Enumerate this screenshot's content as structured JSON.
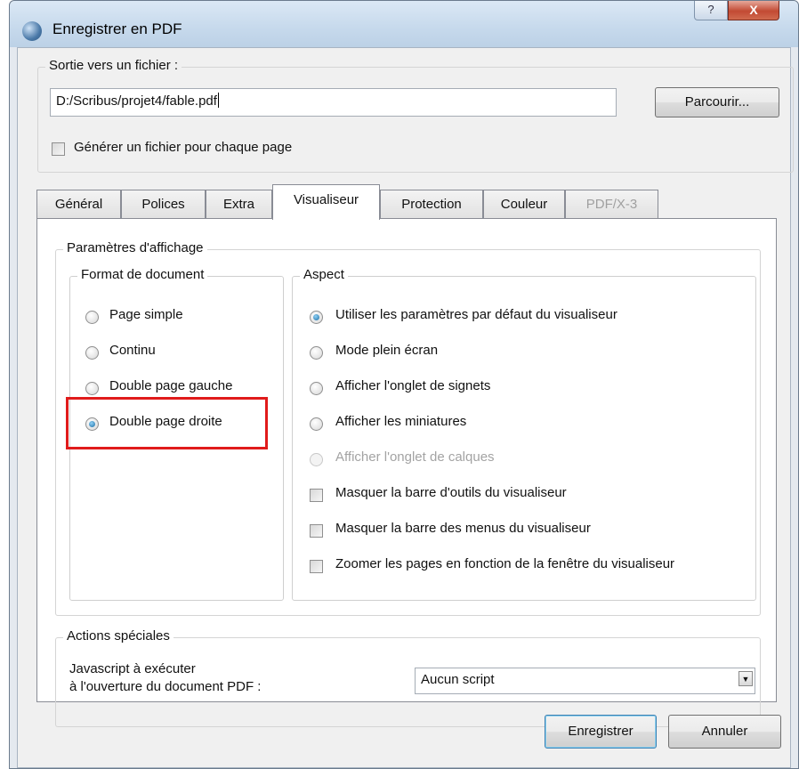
{
  "window": {
    "title": "Enregistrer en PDF",
    "help_glyph": "?",
    "close_glyph": "X"
  },
  "output": {
    "group_label": "Sortie vers un fichier :",
    "path_value": "D:/Scribus/projet4/fable.pdf",
    "browse_label": "Parcourir...",
    "per_page_label": "Générer un fichier pour chaque page",
    "per_page_checked": false
  },
  "tabs": [
    {
      "label": "Général",
      "active": false,
      "disabled": false
    },
    {
      "label": "Polices",
      "active": false,
      "disabled": false
    },
    {
      "label": "Extra",
      "active": false,
      "disabled": false
    },
    {
      "label": "Visualiseur",
      "active": true,
      "disabled": false
    },
    {
      "label": "Protection",
      "active": false,
      "disabled": false
    },
    {
      "label": "Couleur",
      "active": false,
      "disabled": false
    },
    {
      "label": "PDF/X-3",
      "active": false,
      "disabled": true
    }
  ],
  "display_settings": {
    "group_label": "Paramètres d'affichage",
    "document_format": {
      "group_label": "Format de document",
      "options": [
        {
          "label": "Page simple",
          "checked": false
        },
        {
          "label": "Continu",
          "checked": false
        },
        {
          "label": "Double page gauche",
          "checked": false
        },
        {
          "label": "Double page droite",
          "checked": true
        }
      ]
    },
    "aspect": {
      "group_label": "Aspect",
      "radios": [
        {
          "label": "Utiliser les paramètres par défaut du visualiseur",
          "checked": true,
          "disabled": false
        },
        {
          "label": "Mode plein écran",
          "checked": false,
          "disabled": false
        },
        {
          "label": "Afficher l'onglet de signets",
          "checked": false,
          "disabled": false
        },
        {
          "label": "Afficher les miniatures",
          "checked": false,
          "disabled": false
        },
        {
          "label": "Afficher l'onglet de calques",
          "checked": false,
          "disabled": true
        }
      ],
      "checkboxes": [
        {
          "label": "Masquer la barre d'outils du visualiseur",
          "checked": false
        },
        {
          "label": "Masquer la barre des menus du visualiseur",
          "checked": false
        },
        {
          "label": "Zoomer les pages en fonction de la fenêtre du visualiseur",
          "checked": false
        }
      ]
    }
  },
  "special_actions": {
    "group_label": "Actions spéciales",
    "javascript_label_line1": "Javascript à exécuter",
    "javascript_label_line2": "à l'ouverture du document PDF :",
    "script_value": "Aucun script",
    "dropdown_arrow_glyph": "▼"
  },
  "buttons": {
    "save_label": "Enregistrer",
    "cancel_label": "Annuler"
  },
  "annotation": {
    "highlight_color": "#e01b1b"
  }
}
